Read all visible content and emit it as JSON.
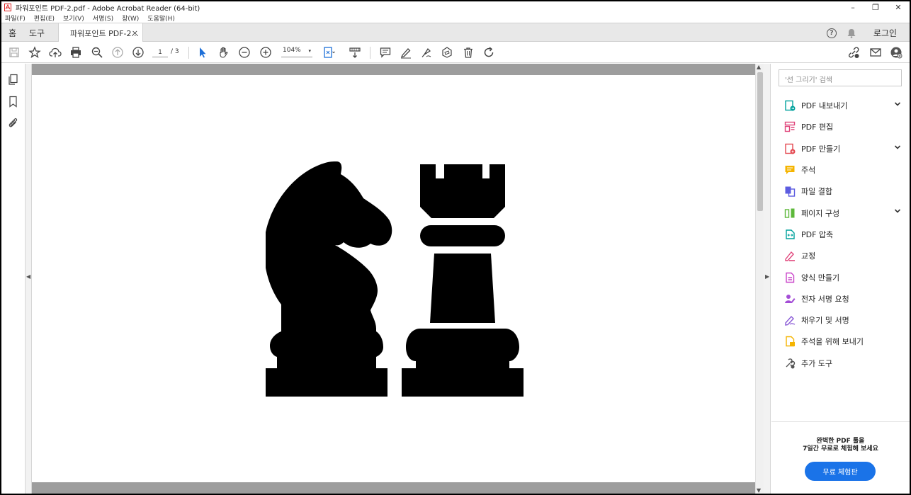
{
  "window": {
    "title": "파워포인트 PDF-2.pdf - Adobe Acrobat Reader (64-bit)",
    "controls": [
      "–",
      "❐",
      "✕"
    ]
  },
  "menu": [
    "파일(F)",
    "편집(E)",
    "보기(V)",
    "서명(S)",
    "창(W)",
    "도움말(H)"
  ],
  "tabs": {
    "home": "홈",
    "tools": "도구",
    "document": "파워포인트 PDF-2...",
    "close": "×",
    "login": "로그인",
    "help": "?"
  },
  "toolbar": {
    "current_page": "1",
    "total_pages": "/ 3",
    "zoom": "104%",
    "zoom_caret": "▾"
  },
  "right_panel": {
    "search_placeholder": "'선 그리기' 검색",
    "tools": [
      {
        "label": "PDF 내보내기",
        "icon": "export-pdf-icon",
        "color": "#00a19c",
        "expandable": true
      },
      {
        "label": "PDF 편집",
        "icon": "edit-pdf-icon",
        "color": "#e0457b",
        "expandable": false
      },
      {
        "label": "PDF 만들기",
        "icon": "create-pdf-icon",
        "color": "#e34850",
        "expandable": true
      },
      {
        "label": "주석",
        "icon": "comment-icon",
        "color": "#f5b400",
        "expandable": false
      },
      {
        "label": "파일 결합",
        "icon": "combine-files-icon",
        "color": "#5c5ce0",
        "expandable": false
      },
      {
        "label": "페이지 구성",
        "icon": "organize-pages-icon",
        "color": "#5db83a",
        "expandable": true
      },
      {
        "label": "PDF 압축",
        "icon": "compress-pdf-icon",
        "color": "#00a19c",
        "expandable": false
      },
      {
        "label": "교정",
        "icon": "redact-icon",
        "color": "#e0457b",
        "expandable": false
      },
      {
        "label": "양식 만들기",
        "icon": "prepare-form-icon",
        "color": "#c943c9",
        "expandable": false
      },
      {
        "label": "전자 서명 요청",
        "icon": "request-signature-icon",
        "color": "#a44ed6",
        "expandable": false
      },
      {
        "label": "채우기 및 서명",
        "icon": "fill-sign-icon",
        "color": "#8a5ad6",
        "expandable": false
      },
      {
        "label": "주석을 위해 보내기",
        "icon": "send-for-comments-icon",
        "color": "#f5b400",
        "expandable": false
      },
      {
        "label": "추가 도구",
        "icon": "more-tools-icon",
        "color": "#555555",
        "expandable": false
      }
    ],
    "promo_line1": "완벽한 PDF 툴을",
    "promo_line2": "7일간 무료로 체험해 보세요",
    "trial_button": "무료 체험판"
  },
  "colors": {
    "accent": "#1a73e8",
    "page_bg": "#9d9d9d"
  }
}
